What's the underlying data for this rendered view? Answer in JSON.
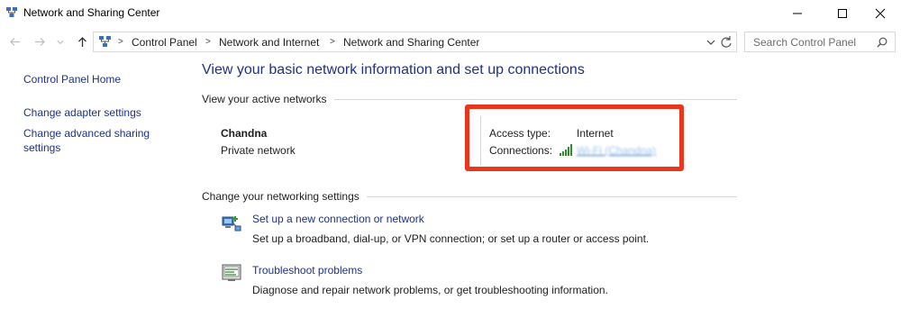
{
  "window": {
    "title": "Network and Sharing Center"
  },
  "address_bar": {
    "breadcrumbs": [
      "Control Panel",
      "Network and Internet",
      "Network and Sharing Center"
    ],
    "search_placeholder": "Search Control Panel"
  },
  "sidebar": {
    "home": "Control Panel Home",
    "adapter": "Change adapter settings",
    "sharing_line1": "Change advanced sharing",
    "sharing_line2": "settings"
  },
  "main": {
    "title": "View your basic network information and set up connections",
    "active_networks_header": "View your active networks",
    "network": {
      "name": "Chandna",
      "category": "Private network",
      "access_type_label": "Access type:",
      "access_type_value": "Internet",
      "connections_label": "Connections:",
      "connection_name": "Wi-Fi (Chandna)"
    },
    "change_settings_header": "Change your networking settings",
    "tasks": [
      {
        "link": "Set up a new connection or network",
        "description": "Set up a broadband, dial-up, or VPN connection; or set up a router or access point."
      },
      {
        "link": "Troubleshoot problems",
        "description": "Diagnose and repair network problems, or get troubleshooting information."
      }
    ]
  },
  "colors": {
    "link": "#1e3287",
    "highlight": "#e8371d",
    "title": "#1e3287"
  }
}
